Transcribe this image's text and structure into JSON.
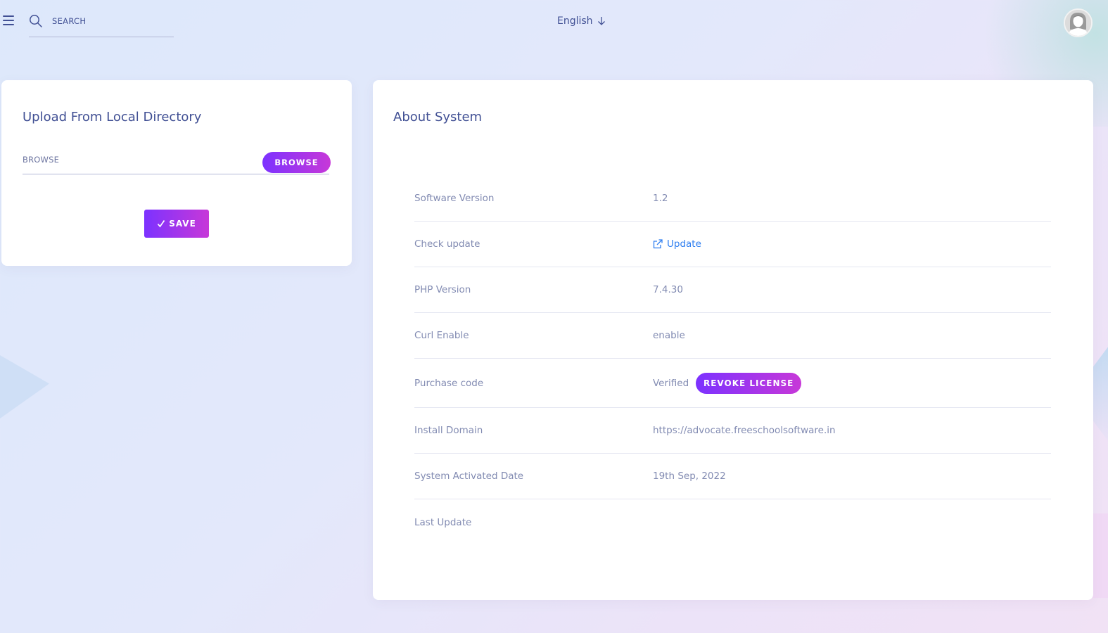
{
  "header": {
    "search_placeholder": "SEARCH",
    "language": "English"
  },
  "upload_card": {
    "title": "Upload From Local Directory",
    "browse_label": "BROWSE",
    "browse_button": "BROWSE",
    "save_button": "SAVE"
  },
  "about_card": {
    "title": "About System",
    "rows": [
      {
        "label": "Software Version",
        "value": "1.2"
      },
      {
        "label": "Check update",
        "value": "Update"
      },
      {
        "label": "PHP Version",
        "value": "7.4.30"
      },
      {
        "label": "Curl Enable",
        "value": "enable"
      },
      {
        "label": "Purchase code",
        "value": "Verified",
        "button": "REVOKE LICENSE"
      },
      {
        "label": "Install Domain",
        "value": "https://advocate.freeschoolsoftware.in"
      },
      {
        "label": "System Activated Date",
        "value": "19th Sep, 2022"
      },
      {
        "label": "Last Update",
        "value": ""
      }
    ]
  },
  "colors": {
    "primary_text": "#415094",
    "muted_text": "#828bb2",
    "gradient_start": "#7c32ff",
    "gradient_end": "#c738d8",
    "link": "#2e7ef0"
  },
  "icons": [
    "menu-icon",
    "search-icon",
    "arrow-down-icon",
    "avatar-icon",
    "check-icon",
    "external-link-icon"
  ]
}
